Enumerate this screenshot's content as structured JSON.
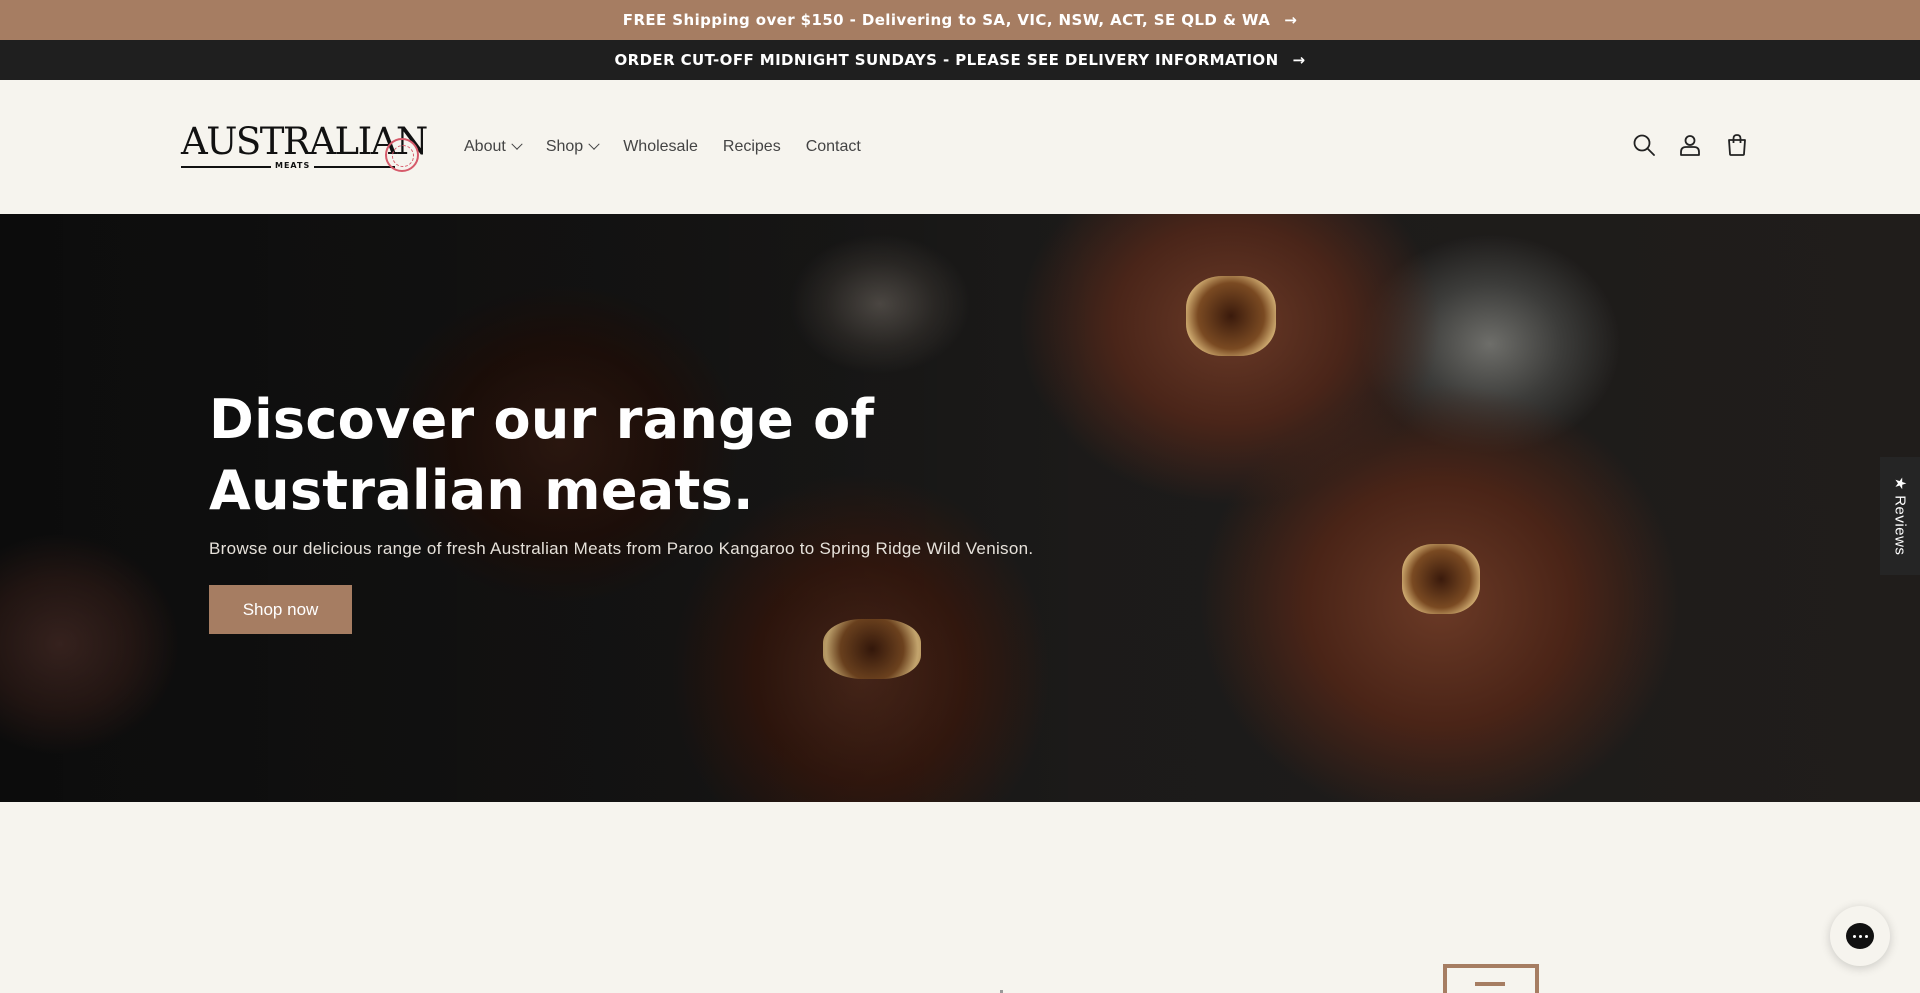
{
  "announcements": {
    "shipping": "FREE Shipping over $150 - Delivering to SA, VIC, NSW, ACT, SE QLD & WA",
    "cutoff": "ORDER CUT-OFF MIDNIGHT SUNDAYS - PLEASE SEE DELIVERY INFORMATION",
    "arrow": "→"
  },
  "logo": {
    "main": "AUSTRALIAN",
    "sub": "MEATS"
  },
  "nav": {
    "items": [
      {
        "label": "About",
        "has_dropdown": true
      },
      {
        "label": "Shop",
        "has_dropdown": true
      },
      {
        "label": "Wholesale",
        "has_dropdown": false
      },
      {
        "label": "Recipes",
        "has_dropdown": false
      },
      {
        "label": "Contact",
        "has_dropdown": false
      }
    ]
  },
  "header_icons": [
    "search-icon",
    "account-icon",
    "cart-icon"
  ],
  "hero": {
    "title": "Discover our range of Australian meats.",
    "subtitle": "Browse our delicious range of fresh Australian Meats from Paroo Kangaroo to Spring Ridge Wild Venison.",
    "button": "Shop now"
  },
  "reviews_tab": "★ Reviews",
  "colors": {
    "accent": "#a67d62",
    "dark_bar": "#1f1f1f",
    "page_bg": "#f6f4ee",
    "logo_seal": "#d65a6a"
  }
}
